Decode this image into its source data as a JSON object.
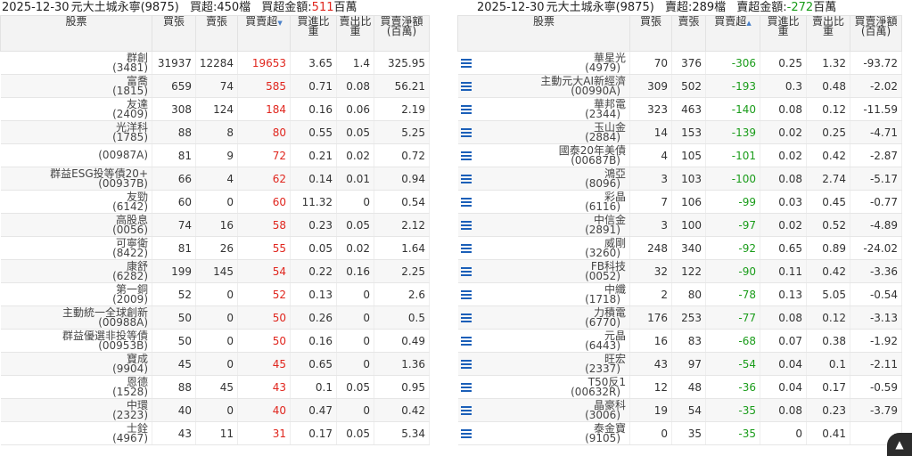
{
  "left": {
    "header": {
      "date": "2025-12-30",
      "broker": "元大土城永寧(9875)",
      "count": "買超:450檔",
      "amount_label": "買超金額:",
      "amount_value": "511",
      "amount_unit": "百萬"
    },
    "columns": [
      "股票",
      "買張",
      "賣張",
      "買賣超",
      "買進比重",
      "賣出比重",
      "買賣淨額(百萬)"
    ],
    "rows": [
      {
        "name": "群創",
        "code": "(3481)",
        "buy": "31937",
        "sell": "12284",
        "net": "19653",
        "buy_pct": "3.65",
        "sell_pct": "1.4",
        "amount": "325.95"
      },
      {
        "name": "富喬",
        "code": "(1815)",
        "buy": "659",
        "sell": "74",
        "net": "585",
        "buy_pct": "0.71",
        "sell_pct": "0.08",
        "amount": "56.21"
      },
      {
        "name": "友達",
        "code": "(2409)",
        "buy": "308",
        "sell": "124",
        "net": "184",
        "buy_pct": "0.16",
        "sell_pct": "0.06",
        "amount": "2.19"
      },
      {
        "name": "光洋科",
        "code": "(1785)",
        "buy": "88",
        "sell": "8",
        "net": "80",
        "buy_pct": "0.55",
        "sell_pct": "0.05",
        "amount": "5.25"
      },
      {
        "name": "",
        "code": "(00987A)",
        "buy": "81",
        "sell": "9",
        "net": "72",
        "buy_pct": "0.21",
        "sell_pct": "0.02",
        "amount": "0.72"
      },
      {
        "name": "群益ESG投等債20+",
        "code": "(00937B)",
        "buy": "66",
        "sell": "4",
        "net": "62",
        "buy_pct": "0.14",
        "sell_pct": "0.01",
        "amount": "0.94"
      },
      {
        "name": "友勁",
        "code": "(6142)",
        "buy": "60",
        "sell": "0",
        "net": "60",
        "buy_pct": "11.32",
        "sell_pct": "0",
        "amount": "0.54"
      },
      {
        "name": "高股息",
        "code": "(0056)",
        "buy": "74",
        "sell": "16",
        "net": "58",
        "buy_pct": "0.23",
        "sell_pct": "0.05",
        "amount": "2.12"
      },
      {
        "name": "可寧衛",
        "code": "(8422)",
        "buy": "81",
        "sell": "26",
        "net": "55",
        "buy_pct": "0.05",
        "sell_pct": "0.02",
        "amount": "1.64"
      },
      {
        "name": "康舒",
        "code": "(6282)",
        "buy": "199",
        "sell": "145",
        "net": "54",
        "buy_pct": "0.22",
        "sell_pct": "0.16",
        "amount": "2.25"
      },
      {
        "name": "第一銅",
        "code": "(2009)",
        "buy": "52",
        "sell": "0",
        "net": "52",
        "buy_pct": "0.13",
        "sell_pct": "0",
        "amount": "2.6"
      },
      {
        "name": "主動統一全球創新",
        "code": "(00988A)",
        "buy": "50",
        "sell": "0",
        "net": "50",
        "buy_pct": "0.26",
        "sell_pct": "0",
        "amount": "0.5"
      },
      {
        "name": "群益優選非投等債",
        "code": "(00953B)",
        "buy": "50",
        "sell": "0",
        "net": "50",
        "buy_pct": "0.16",
        "sell_pct": "0",
        "amount": "0.49"
      },
      {
        "name": "寶成",
        "code": "(9904)",
        "buy": "45",
        "sell": "0",
        "net": "45",
        "buy_pct": "0.65",
        "sell_pct": "0",
        "amount": "1.36"
      },
      {
        "name": "恩德",
        "code": "(1528)",
        "buy": "88",
        "sell": "45",
        "net": "43",
        "buy_pct": "0.1",
        "sell_pct": "0.05",
        "amount": "0.95"
      },
      {
        "name": "中環",
        "code": "(2323)",
        "buy": "40",
        "sell": "0",
        "net": "40",
        "buy_pct": "0.47",
        "sell_pct": "0",
        "amount": "0.42"
      },
      {
        "name": "士銓",
        "code": "(4967)",
        "buy": "43",
        "sell": "11",
        "net": "31",
        "buy_pct": "0.17",
        "sell_pct": "0.05",
        "amount": "5.34"
      }
    ]
  },
  "right": {
    "header": {
      "date": "2025-12-30",
      "broker": "元大土城永寧(9875)",
      "count": "賣超:289檔",
      "amount_label": "賣超金額:",
      "amount_value": "-272",
      "amount_unit": "百萬"
    },
    "columns": [
      "股票",
      "買張",
      "賣張",
      "買賣超",
      "買進比重",
      "賣出比重",
      "買賣淨額(百萬)"
    ],
    "rows": [
      {
        "name": "華星光",
        "code": "(4979)",
        "buy": "70",
        "sell": "376",
        "net": "-306",
        "buy_pct": "0.25",
        "sell_pct": "1.32",
        "amount": "-93.72"
      },
      {
        "name": "主動元大AI新經濟",
        "code": "(00990A)",
        "buy": "309",
        "sell": "502",
        "net": "-193",
        "buy_pct": "0.3",
        "sell_pct": "0.48",
        "amount": "-2.02"
      },
      {
        "name": "華邦電",
        "code": "(2344)",
        "buy": "323",
        "sell": "463",
        "net": "-140",
        "buy_pct": "0.08",
        "sell_pct": "0.12",
        "amount": "-11.59"
      },
      {
        "name": "玉山金",
        "code": "(2884)",
        "buy": "14",
        "sell": "153",
        "net": "-139",
        "buy_pct": "0.02",
        "sell_pct": "0.25",
        "amount": "-4.71"
      },
      {
        "name": "國泰20年美債",
        "code": "(00687B)",
        "buy": "4",
        "sell": "105",
        "net": "-101",
        "buy_pct": "0.02",
        "sell_pct": "0.42",
        "amount": "-2.87"
      },
      {
        "name": "鴻亞",
        "code": "(8096)",
        "buy": "3",
        "sell": "103",
        "net": "-100",
        "buy_pct": "0.08",
        "sell_pct": "2.74",
        "amount": "-5.17"
      },
      {
        "name": "彩晶",
        "code": "(6116)",
        "buy": "7",
        "sell": "106",
        "net": "-99",
        "buy_pct": "0.03",
        "sell_pct": "0.45",
        "amount": "-0.77"
      },
      {
        "name": "中信金",
        "code": "(2891)",
        "buy": "3",
        "sell": "100",
        "net": "-97",
        "buy_pct": "0.02",
        "sell_pct": "0.52",
        "amount": "-4.89"
      },
      {
        "name": "威剛",
        "code": "(3260)",
        "buy": "248",
        "sell": "340",
        "net": "-92",
        "buy_pct": "0.65",
        "sell_pct": "0.89",
        "amount": "-24.02"
      },
      {
        "name": "FB科技",
        "code": "(0052)",
        "buy": "32",
        "sell": "122",
        "net": "-90",
        "buy_pct": "0.11",
        "sell_pct": "0.42",
        "amount": "-3.36"
      },
      {
        "name": "中纖",
        "code": "(1718)",
        "buy": "2",
        "sell": "80",
        "net": "-78",
        "buy_pct": "0.13",
        "sell_pct": "5.05",
        "amount": "-0.54"
      },
      {
        "name": "力積電",
        "code": "(6770)",
        "buy": "176",
        "sell": "253",
        "net": "-77",
        "buy_pct": "0.08",
        "sell_pct": "0.12",
        "amount": "-3.13"
      },
      {
        "name": "元晶",
        "code": "(6443)",
        "buy": "16",
        "sell": "83",
        "net": "-68",
        "buy_pct": "0.07",
        "sell_pct": "0.38",
        "amount": "-1.92"
      },
      {
        "name": "旺宏",
        "code": "(2337)",
        "buy": "43",
        "sell": "97",
        "net": "-54",
        "buy_pct": "0.04",
        "sell_pct": "0.1",
        "amount": "-2.11"
      },
      {
        "name": "T50反1",
        "code": "(00632R)",
        "buy": "12",
        "sell": "48",
        "net": "-36",
        "buy_pct": "0.04",
        "sell_pct": "0.17",
        "amount": "-0.59"
      },
      {
        "name": "晶豪科",
        "code": "(3006)",
        "buy": "19",
        "sell": "54",
        "net": "-35",
        "buy_pct": "0.08",
        "sell_pct": "0.23",
        "amount": "-3.79"
      },
      {
        "name": "泰金寶",
        "code": "(9105)",
        "buy": "0",
        "sell": "35",
        "net": "-35",
        "buy_pct": "0",
        "sell_pct": "0.41",
        "amount": "-"
      }
    ]
  },
  "icons": {
    "list_icon": "list-icon",
    "fab_icon": "chevron-up-icon"
  },
  "colors": {
    "positive": "#e0261e",
    "negative": "#1a9c1a",
    "list_icon": "#1b5fb8"
  }
}
